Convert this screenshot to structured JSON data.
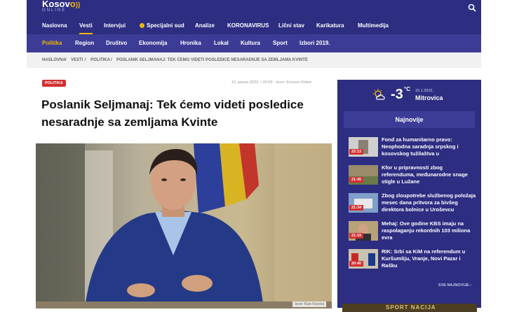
{
  "brand": {
    "logo": "Kosov",
    "logo_suffix": "o",
    "subtitle": "ONLINE"
  },
  "nav_primary": [
    {
      "label": "Naslovna"
    },
    {
      "label": "Vesti",
      "active": true
    },
    {
      "label": "Intervjui"
    },
    {
      "label": "Specijalni sud",
      "dot": true
    },
    {
      "label": "Analize"
    },
    {
      "label": "KORONAVIRUS"
    },
    {
      "label": "Lični stav"
    },
    {
      "label": "Karikatura"
    },
    {
      "label": "Multimedija"
    }
  ],
  "nav_secondary": [
    {
      "label": "Politika",
      "active": true
    },
    {
      "label": "Region"
    },
    {
      "label": "Društvo"
    },
    {
      "label": "Ekonomija"
    },
    {
      "label": "Hronika"
    },
    {
      "label": "Lokal"
    },
    {
      "label": "Kultura"
    },
    {
      "label": "Sport"
    },
    {
      "label": "Izbori 2019."
    }
  ],
  "breadcrumb": [
    "NASLOVNA",
    "/",
    "VESTI",
    "/",
    "POLITIKA",
    "/",
    "POSLANIK SELJMANAJ: TEK ĆEMO VIDETI POSLEDICE NESARADNJE SA ZEMLJAMA KVINTE"
  ],
  "article": {
    "tag": "POLITIKA",
    "meta": "15. januar 2022. • 20:09  ·  Izvor: Kosovo Online",
    "title": "Poslanik Seljmanaj: Tek ćemo videti posledice nesaradnje sa zemljama Kvinte",
    "photo_caption": "Izvor: Klan Kosova"
  },
  "weather": {
    "temp": "-3",
    "unit": "°C",
    "date": "15.1.2022.",
    "city": "Mitrovica"
  },
  "sidebar": {
    "heading": "Najnovije",
    "items": [
      {
        "time": "22:13",
        "text": "Fond za humanitarno pravo: Neophodna saradnja srpskog i kosovskog tužilaštva u"
      },
      {
        "time": "21:45",
        "text": "Kfor u pripravnosti zbog referenduma, međunarodne snage stigle u Lužane"
      },
      {
        "time": "21:34",
        "text": "Zbog zloupotrebe službenog položaja mesec dana pritvora za bivšeg direktora bolnice u Uroševcu"
      },
      {
        "time": "21:19",
        "text": "Mehaj: Ove godine KBS imaju na raspolaganju rekordnih 103 miliona evra"
      },
      {
        "time": "20:40",
        "text": "RIK: Srbi sa KiM na referendum u Kuršumliju, Vranje, Novi Pazar i Rašku"
      }
    ],
    "more": "SVE NAJNOVIJE ›"
  },
  "banner": {
    "text": "SPORT NACIJA"
  },
  "colors": {
    "primary": "#2d2d82",
    "accent": "#f2b705",
    "tag": "#d32f2f"
  }
}
